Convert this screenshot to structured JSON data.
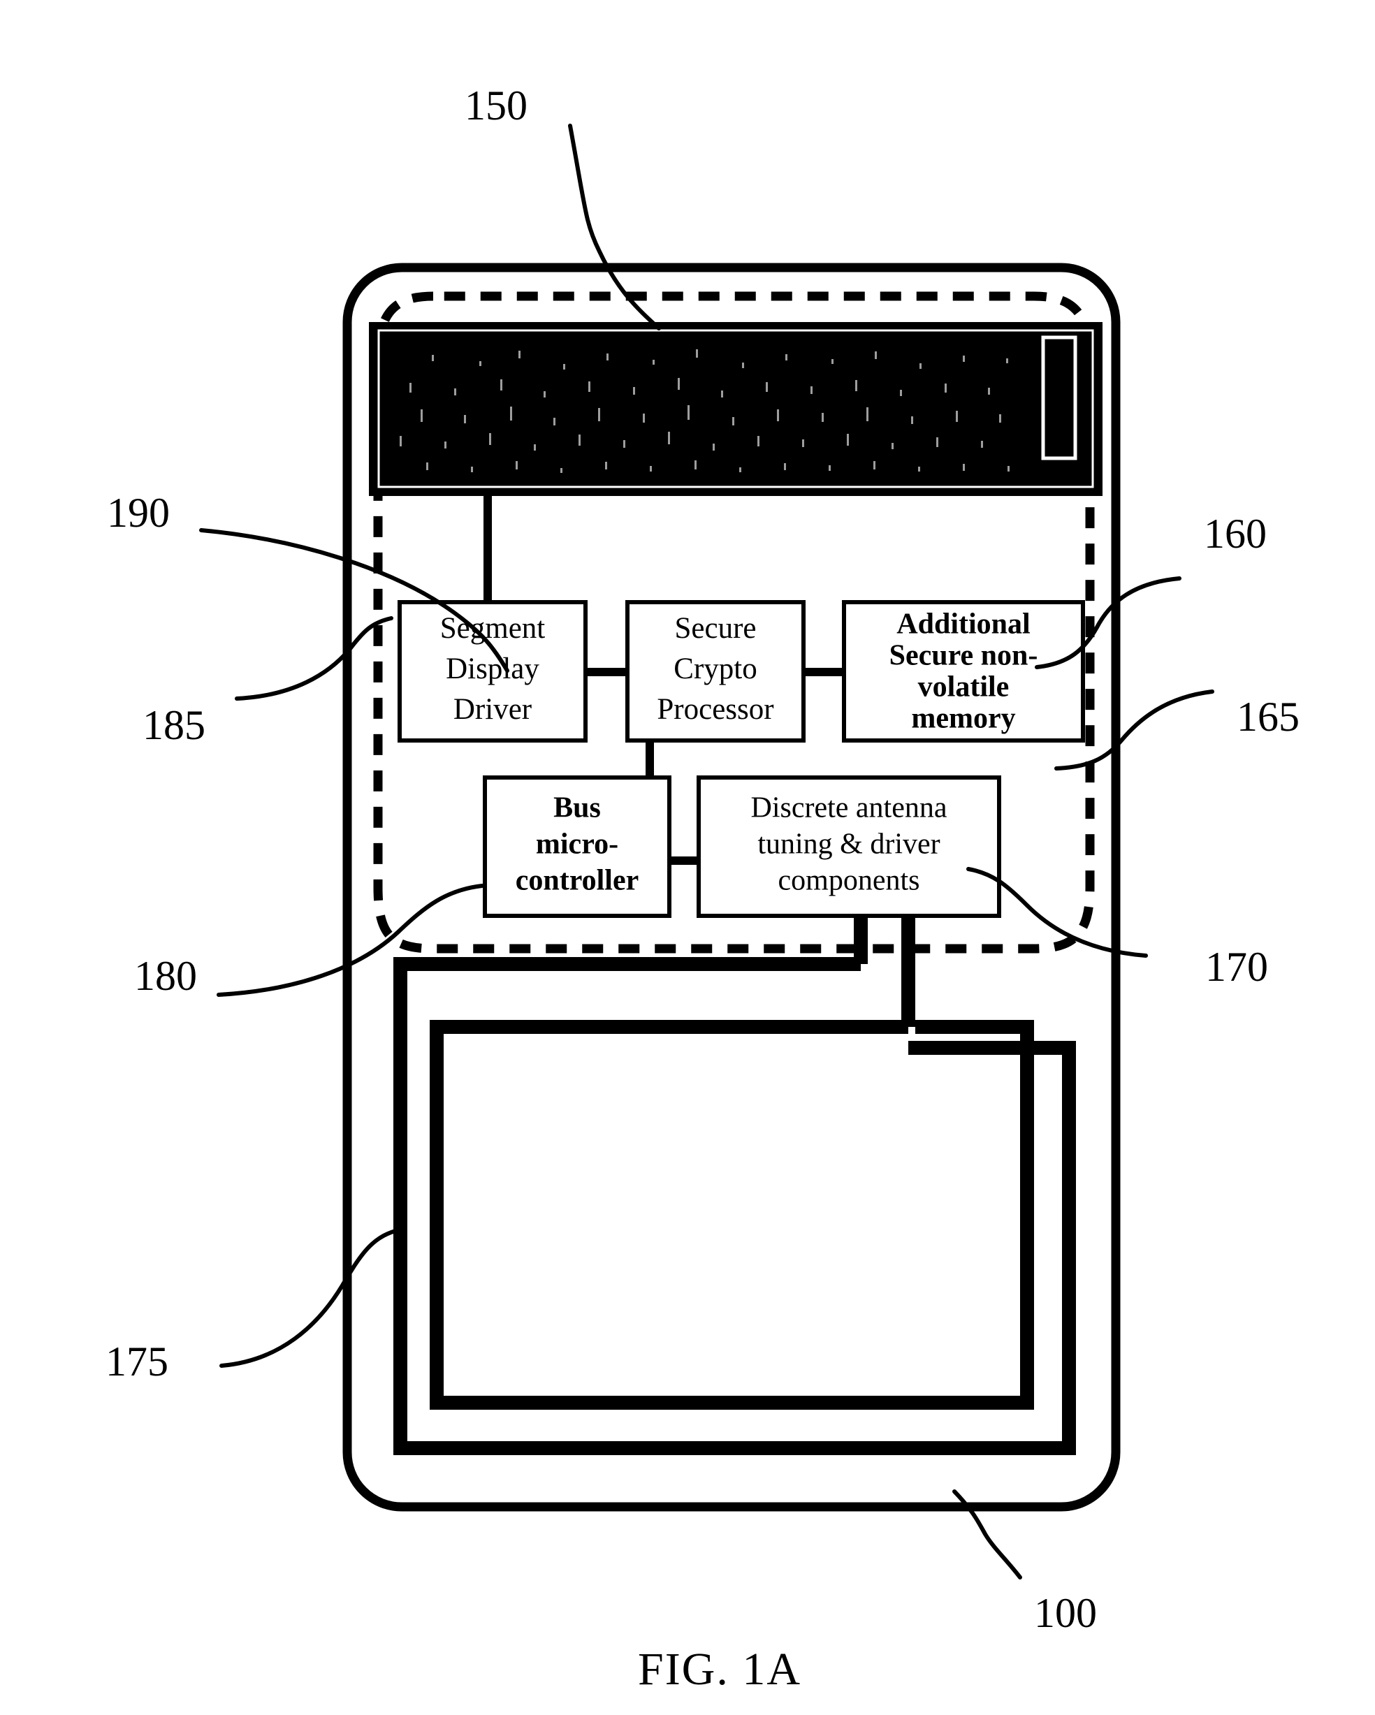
{
  "figure": {
    "caption": "FIG. 1A",
    "title": "Smart card with segment display, secure crypto processor and NFC antenna"
  },
  "reference_numerals": [
    {
      "id": "150",
      "label": "150",
      "target": "segment-display"
    },
    {
      "id": "190",
      "label": "190",
      "target": "segment-display-driver"
    },
    {
      "id": "185",
      "label": "185",
      "target": "secure-boundary-left"
    },
    {
      "id": "160",
      "label": "160",
      "target": "secure-crypto-processor"
    },
    {
      "id": "165",
      "label": "165",
      "target": "additional-secure-nonvolatile-memory"
    },
    {
      "id": "180",
      "label": "180",
      "target": "bus-microcontroller"
    },
    {
      "id": "170",
      "label": "170",
      "target": "discrete-antenna-tuning-driver-components"
    },
    {
      "id": "175",
      "label": "175",
      "target": "antenna-coil"
    },
    {
      "id": "100",
      "label": "100",
      "target": "card-body"
    }
  ],
  "components": {
    "segment_display_driver": {
      "name": "segment-display-driver",
      "lines": [
        "Segment",
        "Display",
        "Driver"
      ],
      "bold": false
    },
    "secure_crypto_processor": {
      "name": "secure-crypto-processor",
      "lines": [
        "Secure",
        "Crypto",
        "Processor"
      ],
      "bold": false
    },
    "additional_secure_memory": {
      "name": "additional-secure-nonvolatile-memory",
      "lines": [
        "Additional",
        "Secure non-",
        "volatile",
        "memory"
      ],
      "bold": true
    },
    "bus_microcontroller": {
      "name": "bus-microcontroller",
      "lines": [
        "Bus",
        "micro-",
        "controller"
      ],
      "bold": true
    },
    "discrete_antenna": {
      "name": "discrete-antenna-tuning-driver-components",
      "lines": [
        "Discrete antenna",
        "tuning & driver",
        "components"
      ],
      "bold": false
    }
  },
  "elements": {
    "card_body_label": "card-body",
    "secure_boundary_label": "secure-element-boundary",
    "display_label": "segment-display",
    "display_icon_label": "battery-indicator-icon",
    "antenna_label": "antenna-coil"
  },
  "colors": {
    "ink": "#000000",
    "paper": "#ffffff",
    "display_background": "#000000",
    "display_foreground": "#ffffff"
  }
}
